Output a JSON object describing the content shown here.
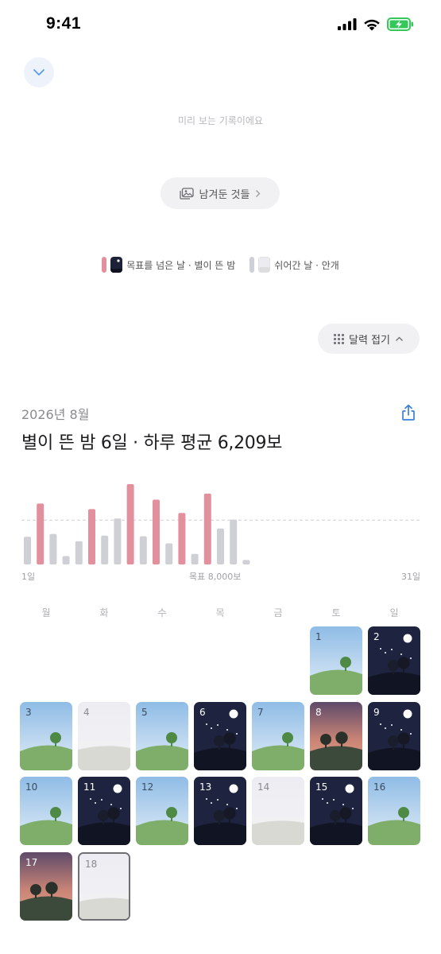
{
  "status_bar": {
    "time": "9:41"
  },
  "preview_note": "미리 보는 기록이에요",
  "saved_button": {
    "label": "남겨둔 것들"
  },
  "legend": {
    "goal_label": "목표를 넘은 날 · 별이 뜬 밤",
    "rest_label": "쉬어간 날 · 안개",
    "goal_color": "#e3909e",
    "rest_color": "#cfd0d6"
  },
  "fold_button": {
    "label": "달력 접기"
  },
  "month_label": "2026년 8월",
  "summary": "별이 뜬 밤 6일 · 하루 평균 6,209보",
  "chart_data": {
    "type": "bar",
    "x": [
      1,
      2,
      3,
      4,
      5,
      6,
      7,
      8,
      9,
      10,
      11,
      12,
      13,
      14,
      15,
      16,
      17,
      18
    ],
    "values": [
      5000,
      11000,
      5500,
      1500,
      4200,
      10000,
      5200,
      8300,
      14500,
      5100,
      11700,
      3800,
      9300,
      1900,
      12800,
      6500,
      8100,
      800
    ],
    "goal_met": [
      false,
      true,
      false,
      false,
      false,
      true,
      false,
      false,
      true,
      false,
      true,
      false,
      true,
      false,
      true,
      false,
      false,
      false
    ],
    "goal": 8000,
    "goal_label": "목표 8,000보",
    "start_label": "1일",
    "end_label": "31일",
    "ylim": [
      0,
      15500
    ],
    "goal_color": "#e3909e",
    "rest_color": "#cfd0d6"
  },
  "weekdays": [
    "월",
    "화",
    "수",
    "목",
    "금",
    "토",
    "일"
  ],
  "calendar": {
    "first_weekday_index": 5,
    "today": 18,
    "days": [
      {
        "day": "1",
        "type": "day"
      },
      {
        "day": "2",
        "type": "night"
      },
      {
        "day": "3",
        "type": "day"
      },
      {
        "day": "4",
        "type": "fog"
      },
      {
        "day": "5",
        "type": "day"
      },
      {
        "day": "6",
        "type": "night"
      },
      {
        "day": "7",
        "type": "day"
      },
      {
        "day": "8",
        "type": "dusk"
      },
      {
        "day": "9",
        "type": "night"
      },
      {
        "day": "10",
        "type": "day"
      },
      {
        "day": "11",
        "type": "night"
      },
      {
        "day": "12",
        "type": "day"
      },
      {
        "day": "13",
        "type": "night"
      },
      {
        "day": "14",
        "type": "fog"
      },
      {
        "day": "15",
        "type": "night"
      },
      {
        "day": "16",
        "type": "day"
      },
      {
        "day": "17",
        "type": "dusk"
      },
      {
        "day": "18",
        "type": "fog"
      }
    ]
  }
}
